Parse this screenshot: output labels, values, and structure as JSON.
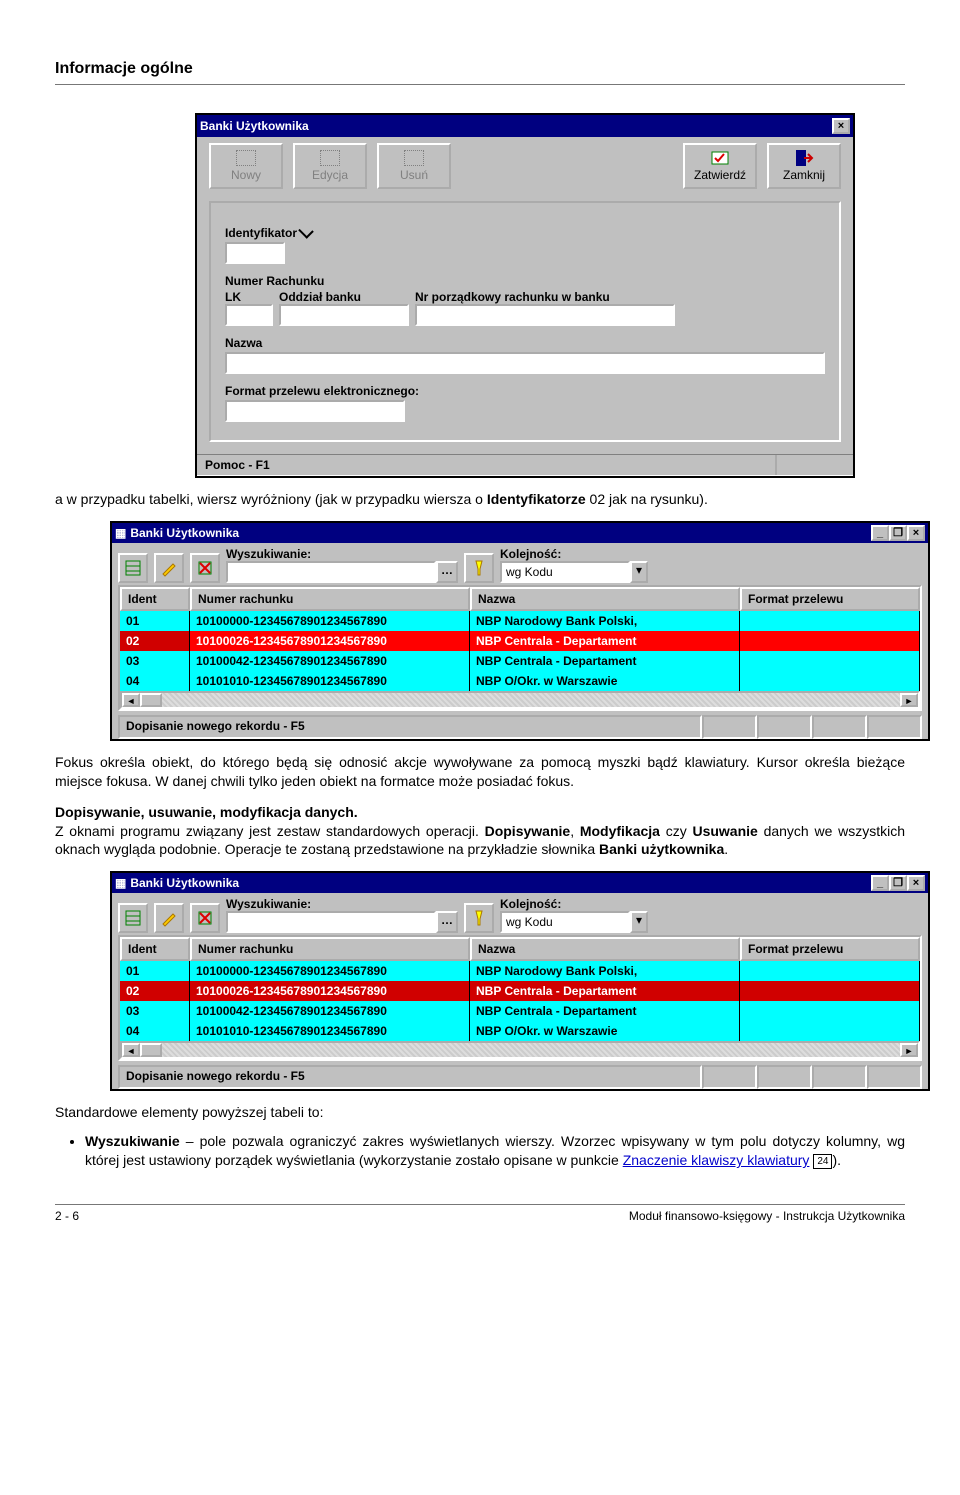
{
  "page_header": "Informacje ogólne",
  "dialog1": {
    "title": "Banki Użytkownika",
    "toolbar": {
      "nowy": "Nowy",
      "edycja": "Edycja",
      "usun": "Usuń",
      "zatwierdz": "Zatwierdź",
      "zamknij": "Zamknij"
    },
    "labels": {
      "ident": "Identyfikator",
      "numer": "Numer Rachunku",
      "lk": "LK",
      "oddzial": "Oddział banku",
      "nrp": "Nr porządkowy rachunku w banku",
      "nazwa": "Nazwa",
      "format": "Format przelewu elektronicznego:"
    },
    "status": "Pomoc - F1"
  },
  "para1_a": "a w przypadku tabelki, wiersz wyróżniony (jak w przypadku wiersza o ",
  "para1_b": "Identyfikatorze",
  "para1_c": " 02 jak na rysunku).",
  "listwin": {
    "title": "Banki Użytkownika",
    "labels": {
      "wysz": "Wyszukiwanie:",
      "kol": "Kolejność:"
    },
    "sort_value": "wg Kodu",
    "columns": {
      "c1": "Ident",
      "c2": "Numer rachunku",
      "c3": "Nazwa",
      "c4": "Format przelewu"
    },
    "rows": [
      {
        "ident": "01",
        "nr": "10100000-12345678901234567890",
        "nazwa": "NBP Narodowy Bank Polski,"
      },
      {
        "ident": "02",
        "nr": "10100026-12345678901234567890",
        "nazwa": "NBP Centrala - Departament"
      },
      {
        "ident": "03",
        "nr": "10100042-12345678901234567890",
        "nazwa": "NBP Centrala - Departament"
      },
      {
        "ident": "04",
        "nr": "10101010-12345678901234567890",
        "nazwa": "NBP O/Okr. w Warszawie"
      }
    ],
    "status": "Dopisanie nowego rekordu - F5"
  },
  "para2": "Fokus określa obiekt, do którego będą się odnosić akcje wywoływane za pomocą myszki bądź klawiatury. Kursor określa bieżące miejsce fokusa. W danej chwili tylko jeden obiekt na formatce może posiadać fokus.",
  "para3_head": "Dopisywanie, usuwanie, modyfikacja danych.",
  "para3_a": "Z oknami programu związany jest zestaw standardowych operacji. ",
  "para3_b": "Dopisywanie",
  "para3_c": ", ",
  "para3_d": "Modyfikacja",
  "para3_e": " czy ",
  "para3_f": "Usuwanie",
  "para3_g": " danych we wszystkich oknach wygląda podobnie. Operacje te zostaną przedstawione na przykładzie słownika ",
  "para3_h": "Banki użytkownika",
  "para3_i": ".",
  "para4": "Standardowe elementy powyższej tabeli to:",
  "bullet1_a": "Wyszukiwanie",
  "bullet1_b": " – pole pozwala ograniczyć zakres wyświetlanych wierszy. Wzorzec wpisywany w tym polu dotyczy kolumny, wg której jest ustawiony porządek wyświetlania (wykorzystanie zostało opisane w punkcie ",
  "bullet1_link": "Znaczenie klawiszy klawiatury",
  "bullet1_badge": "24",
  "bullet1_c": ").",
  "footer_left": "2 - 6",
  "footer_right": "Moduł finansowo-księgowy - Instrukcja Użytkownika"
}
